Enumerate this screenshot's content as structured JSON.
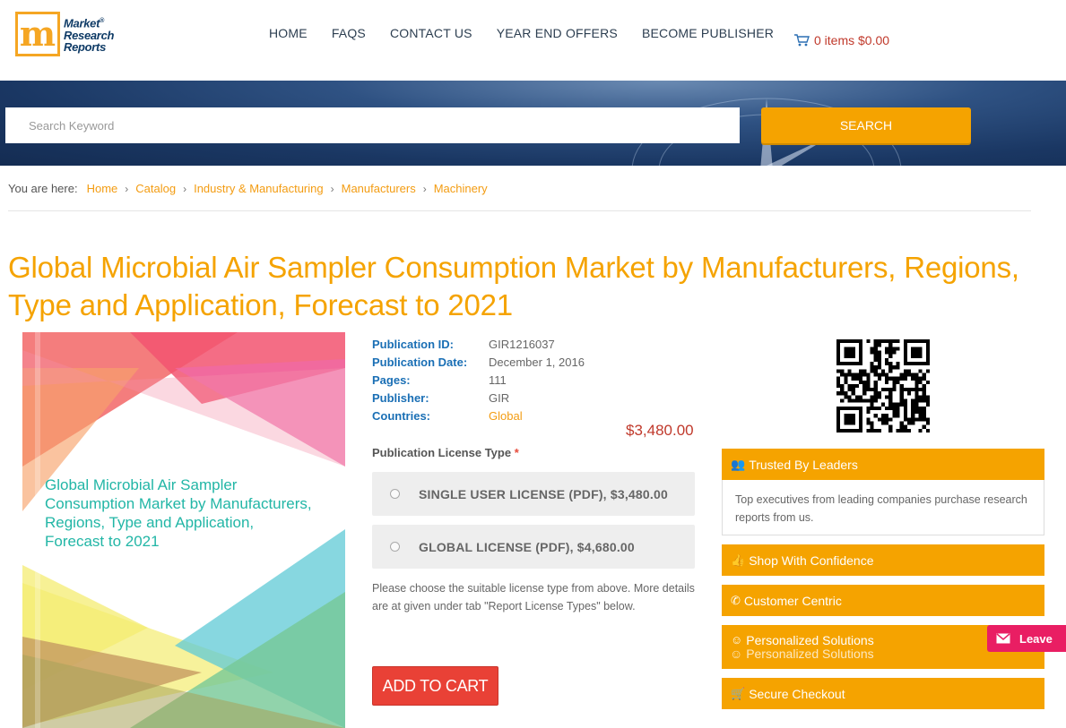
{
  "header": {
    "logo": {
      "line1": "Market",
      "line2": "Research",
      "line3": "Reports",
      "reg": "®",
      "accent": "#f5a623"
    },
    "nav": [
      "HOME",
      "FAQS",
      "CONTACT US",
      "YEAR END OFFERS",
      "BECOME PUBLISHER"
    ],
    "cart": {
      "icon": "cart-icon",
      "text": "0 items $0.00"
    }
  },
  "search": {
    "placeholder": "Search Keyword",
    "button": "SEARCH"
  },
  "breadcrumb": {
    "lead": "You are here:",
    "items": [
      "Home",
      "Catalog",
      "Industry & Manufacturing",
      "Manufacturers",
      "Machinery"
    ]
  },
  "report": {
    "title": "Global Microbial Air Sampler Consumption Market by Manufacturers, Regions, Type and Application, Forecast to 2021",
    "cover_title": "Global Microbial Air Sampler Consumption Market by Manufacturers, Regions, Type and Application, Forecast to 2021",
    "meta": [
      {
        "label": "Publication ID:",
        "value": "GIR1216037"
      },
      {
        "label": "Publication Date:",
        "value": "December 1, 2016"
      },
      {
        "label": "Pages:",
        "value": "111"
      },
      {
        "label": "Publisher:",
        "value": "GIR"
      },
      {
        "label": "Countries:",
        "value": "Global"
      }
    ],
    "price": "$3,480.00",
    "license_label": "Publication License Type",
    "license_required": "*",
    "licenses": [
      "SINGLE USER LICENSE (PDF), $3,480.00",
      "GLOBAL LICENSE (PDF), $4,680.00"
    ],
    "license_note": "Please choose the suitable license type from above. More details are at given under tab \"Report License Types\" below.",
    "add_to_cart": "ADD TO CART"
  },
  "sidebar": {
    "trusted": {
      "icon": "users-icon",
      "title": "Trusted By Leaders",
      "body": "Top executives from leading companies purchase research reports from us."
    },
    "features": [
      {
        "icon": "thumbs-up-icon",
        "label": "Shop With Confidence"
      },
      {
        "icon": "phone-icon",
        "label": "Customer Centric"
      },
      {
        "icon": "smile-icon",
        "label": "Personalized Solutions"
      },
      {
        "icon": "cart-icon",
        "label": "Secure Checkout"
      }
    ],
    "ghost_label": "Personalized Solutions"
  },
  "leave_tab": {
    "icon": "envelope-icon",
    "label": "Leave"
  },
  "colors": {
    "accent": "#f5a300",
    "link_blue": "#1a6fb5",
    "price_red": "#c0392b",
    "cart_button": "#e94136",
    "leave_pink": "#e91e63"
  }
}
